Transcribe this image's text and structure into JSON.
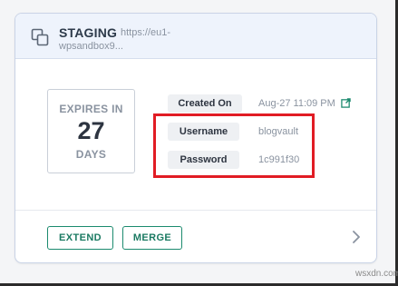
{
  "site": {
    "name": "STAGING",
    "url_line1": "https://eu1-",
    "url_line2": "wpsandbox9..."
  },
  "expiry": {
    "label": "EXPIRES IN",
    "count": "27",
    "unit": "DAYS"
  },
  "details": {
    "created_label": "Created On",
    "created_value": "Aug-27 11:09 PM",
    "username_label": "Username",
    "username_value": "blogvault",
    "password_label": "Password",
    "password_value": "1c991f30"
  },
  "actions": {
    "extend_label": "EXTEND",
    "merge_label": "MERGE"
  },
  "icons": {
    "copy": "copy-icon",
    "external_link": "external-link-icon",
    "chevron": "chevron-right-icon"
  },
  "colors": {
    "accent": "#1b8a6e",
    "header_bg": "#eef3fc",
    "highlight": "#e11c24"
  },
  "watermark": "wsxdn.com"
}
